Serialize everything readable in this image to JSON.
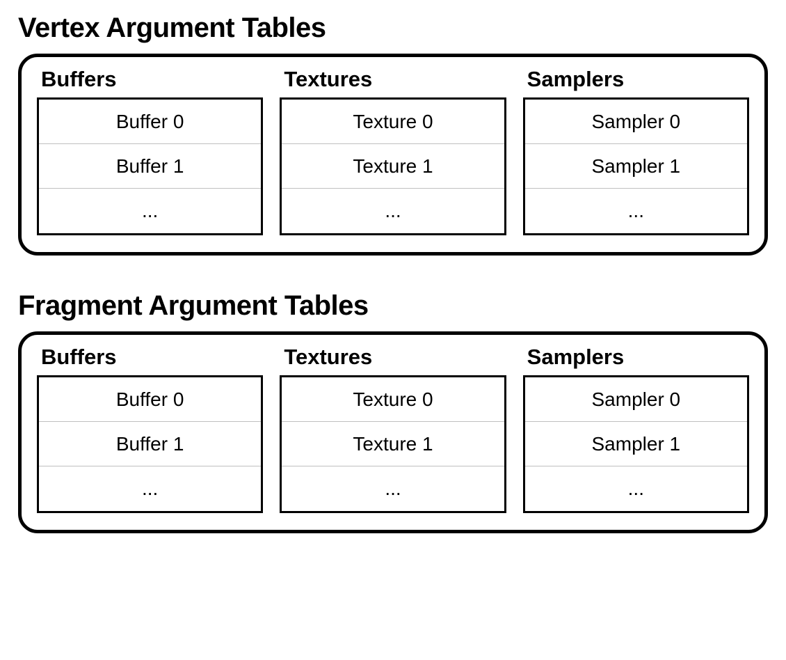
{
  "sections": [
    {
      "id": "vertex",
      "title": "Vertex Argument Tables",
      "columns": [
        {
          "id": "buffers",
          "title": "Buffers",
          "rows": [
            "Buffer 0",
            "Buffer 1",
            "..."
          ]
        },
        {
          "id": "textures",
          "title": "Textures",
          "rows": [
            "Texture 0",
            "Texture 1",
            "..."
          ]
        },
        {
          "id": "samplers",
          "title": "Samplers",
          "rows": [
            "Sampler 0",
            "Sampler 1",
            "..."
          ]
        }
      ]
    },
    {
      "id": "fragment",
      "title": "Fragment Argument Tables",
      "columns": [
        {
          "id": "buffers",
          "title": "Buffers",
          "rows": [
            "Buffer 0",
            "Buffer 1",
            "..."
          ]
        },
        {
          "id": "textures",
          "title": "Textures",
          "rows": [
            "Texture 0",
            "Texture 1",
            "..."
          ]
        },
        {
          "id": "samplers",
          "title": "Samplers",
          "rows": [
            "Sampler 0",
            "Sampler 1",
            "..."
          ]
        }
      ]
    }
  ]
}
